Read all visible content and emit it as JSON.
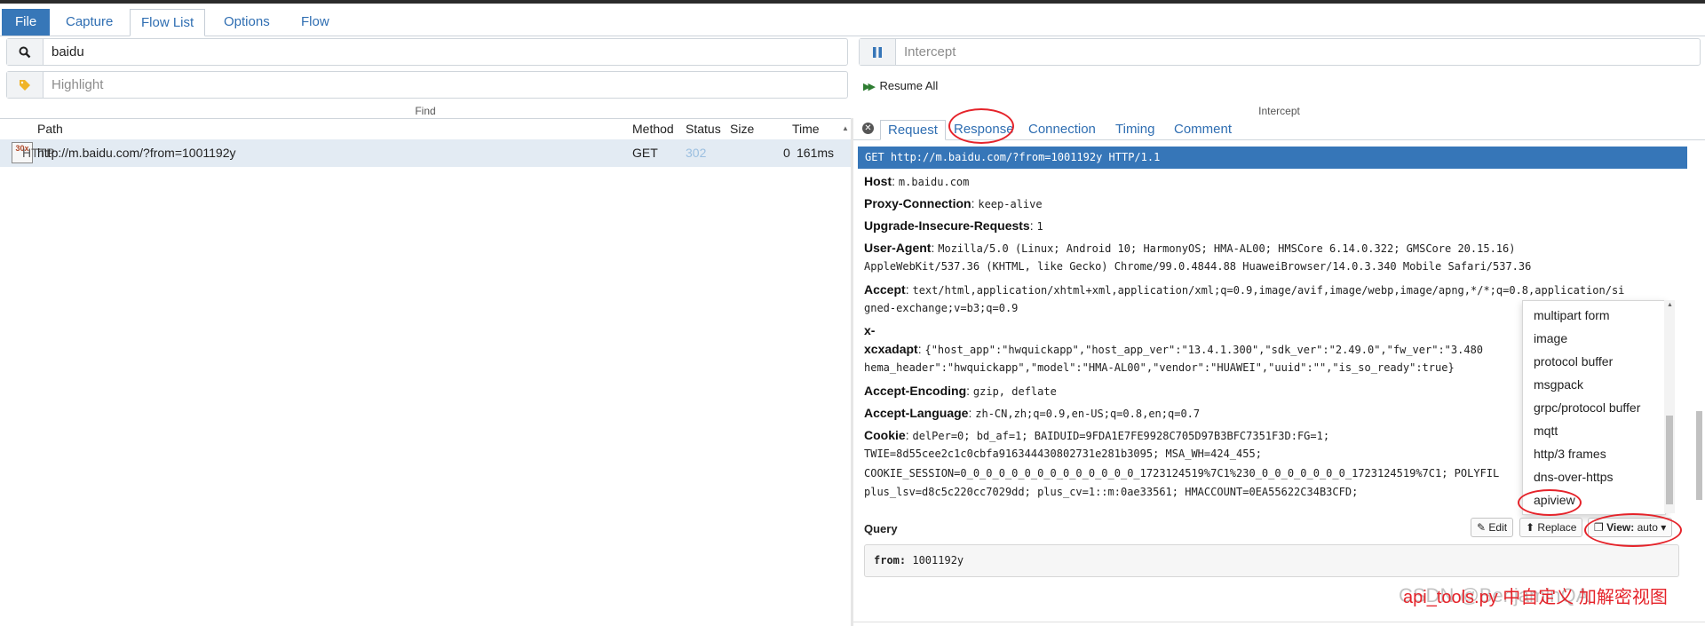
{
  "menu": {
    "tabs": [
      {
        "label": "File"
      },
      {
        "label": "Capture"
      },
      {
        "label": "Flow List"
      },
      {
        "label": "Options"
      },
      {
        "label": "Flow"
      }
    ]
  },
  "find": {
    "search_value": "baidu",
    "highlight_placeholder": "Highlight",
    "label": "Find"
  },
  "intercept": {
    "placeholder": "Intercept",
    "resume_label": "Resume All",
    "label": "Intercept"
  },
  "flow_list": {
    "columns": {
      "path": "Path",
      "method": "Method",
      "status": "Status",
      "size": "Size",
      "time": "Time"
    },
    "rows": [
      {
        "icon_top": "HTTP",
        "icon_code": "30x",
        "path": "http://m.baidu.com/?from=1001192y",
        "method": "GET",
        "status": "302",
        "size": "0",
        "time": "161ms"
      }
    ]
  },
  "detail": {
    "tabs": [
      {
        "label": "Request"
      },
      {
        "label": "Response"
      },
      {
        "label": "Connection"
      },
      {
        "label": "Timing"
      },
      {
        "label": "Comment"
      }
    ],
    "request_line": "GET http://m.baidu.com/?from=1001192y HTTP/1.1",
    "headers": [
      {
        "key": "Host",
        "value": "m.baidu.com"
      },
      {
        "key": "Proxy-Connection",
        "value": "keep-alive"
      },
      {
        "key": "Upgrade-Insecure-Requests",
        "value": "1"
      },
      {
        "key": "User-Agent",
        "value": "Mozilla/5.0 (Linux; Android 10; HarmonyOS; HMA-AL00; HMSCore 6.14.0.322; GMSCore 20.15.16)",
        "value2": "AppleWebKit/537.36 (KHTML, like Gecko) Chrome/99.0.4844.88 HuaweiBrowser/14.0.3.340 Mobile Safari/537.36"
      },
      {
        "key": "Accept",
        "value": "text/html,application/xhtml+xml,application/xml;q=0.9,image/avif,image/webp,image/apng,*/*;q=0.8,application/si",
        "value2": "gned-exchange;v=b3;q=0.9"
      },
      {
        "key": "x-",
        "key2": "xcxadapt",
        "value": "{\"host_app\":\"hwquickapp\",\"host_app_ver\":\"13.4.1.300\",\"sdk_ver\":\"2.49.0\",\"fw_ver\":\"3.480",
        "value2": "hema_header\":\"hwquickapp\",\"model\":\"HMA-AL00\",\"vendor\":\"HUAWEI\",\"uuid\":\"\",\"is_so_ready\":true}"
      },
      {
        "key": "Accept-Encoding",
        "value": "gzip, deflate"
      },
      {
        "key": "Accept-Language",
        "value": "zh-CN,zh;q=0.9,en-US;q=0.8,en;q=0.7"
      },
      {
        "key": "Cookie",
        "value": "delPer=0; bd_af=1; BAIDUID=9FDA1E7FE9928C705D97B3BFC7351F3D:FG=1;",
        "value2": "TWIE=8d55cee2c1c0cbfa916344430802731e281b3095; MSA_WH=424_455;",
        "value3": "COOKIE_SESSION=0_0_0_0_0_0_0_0_0_0_0_0_0_0_1723124519%7C1%230_0_0_0_0_0_0_0_1723124519%7C1; POLYFIL",
        "value4": "plus_lsv=d8c5c220cc7029dd; plus_cv=1::m:0ae33561; HMACCOUNT=0EA55622C34B3CFD;"
      }
    ],
    "view_options": [
      "multipart form",
      "image",
      "protocol buffer",
      "msgpack",
      "grpc/protocol buffer",
      "mqtt",
      "http/3 frames",
      "dns-over-https",
      "apiview"
    ],
    "query": {
      "label": "Query",
      "edit_label": "Edit",
      "replace_label": "Replace",
      "view_label": "View:",
      "view_value": "auto",
      "key": "from:",
      "value": "1001192y"
    }
  },
  "annotation": {
    "text": "api_tools.py 中自定义 加解密视图",
    "watermark": "CSDN @BenjaminQA"
  },
  "colors": {
    "accent": "#3676b8",
    "annotation": "#e5232a"
  }
}
